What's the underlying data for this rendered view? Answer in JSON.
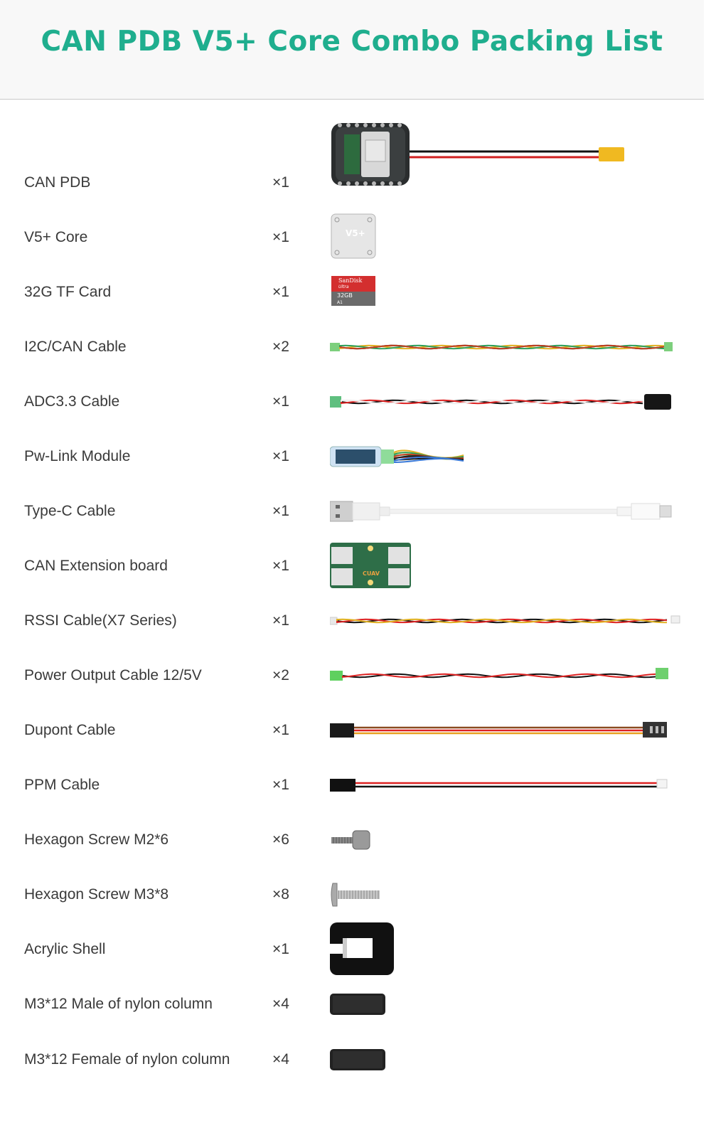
{
  "header": {
    "title": "CAN PDB V5+ Core Combo Packing List"
  },
  "items": [
    {
      "name": "CAN PDB",
      "qty": "×1",
      "icon": "pdb-board-with-xt60-image"
    },
    {
      "name": "V5+ Core",
      "qty": "×1",
      "icon": "v5-core-module-image",
      "icon_text": "V5+"
    },
    {
      "name": "32G TF Card",
      "qty": "×1",
      "icon": "sd-card-image",
      "icon_text": [
        "SanDisk",
        "Ultra",
        "32GB",
        "A1"
      ]
    },
    {
      "name": "I2C/CAN Cable",
      "qty": "×2",
      "icon": "i2c-can-cable-image"
    },
    {
      "name": "ADC3.3 Cable",
      "qty": "×1",
      "icon": "adc-cable-image"
    },
    {
      "name": "Pw-Link Module",
      "qty": "×1",
      "icon": "pw-link-module-image"
    },
    {
      "name": "Type-C Cable",
      "qty": "×1",
      "icon": "type-c-cable-image"
    },
    {
      "name": "CAN Extension board",
      "qty": "×1",
      "icon": "can-extension-board-image",
      "icon_text": "CUAV"
    },
    {
      "name": "RSSI Cable(X7 Series)",
      "qty": "×1",
      "icon": "rssi-cable-image"
    },
    {
      "name": "Power Output Cable 12/5V",
      "qty": "×2",
      "icon": "power-output-cable-image"
    },
    {
      "name": "Dupont Cable",
      "qty": "×1",
      "icon": "dupont-cable-image"
    },
    {
      "name": "PPM Cable",
      "qty": "×1",
      "icon": "ppm-cable-image"
    },
    {
      "name": "Hexagon Screw M2*6",
      "qty": "×6",
      "icon": "hex-screw-m2-image"
    },
    {
      "name": "Hexagon Screw M3*8",
      "qty": "×8",
      "icon": "hex-screw-m3-image"
    },
    {
      "name": "Acrylic Shell",
      "qty": "×1",
      "icon": "acrylic-shell-image"
    },
    {
      "name": "M3*12 Male of nylon column",
      "qty": "×4",
      "icon": "nylon-column-male-image"
    },
    {
      "name": "M3*12 Female of nylon column",
      "qty": "×4",
      "icon": "nylon-column-female-image"
    }
  ],
  "colors": {
    "title": "#1fae8e",
    "text": "#3a3a3a",
    "header_bg": "#f8f8f8"
  }
}
